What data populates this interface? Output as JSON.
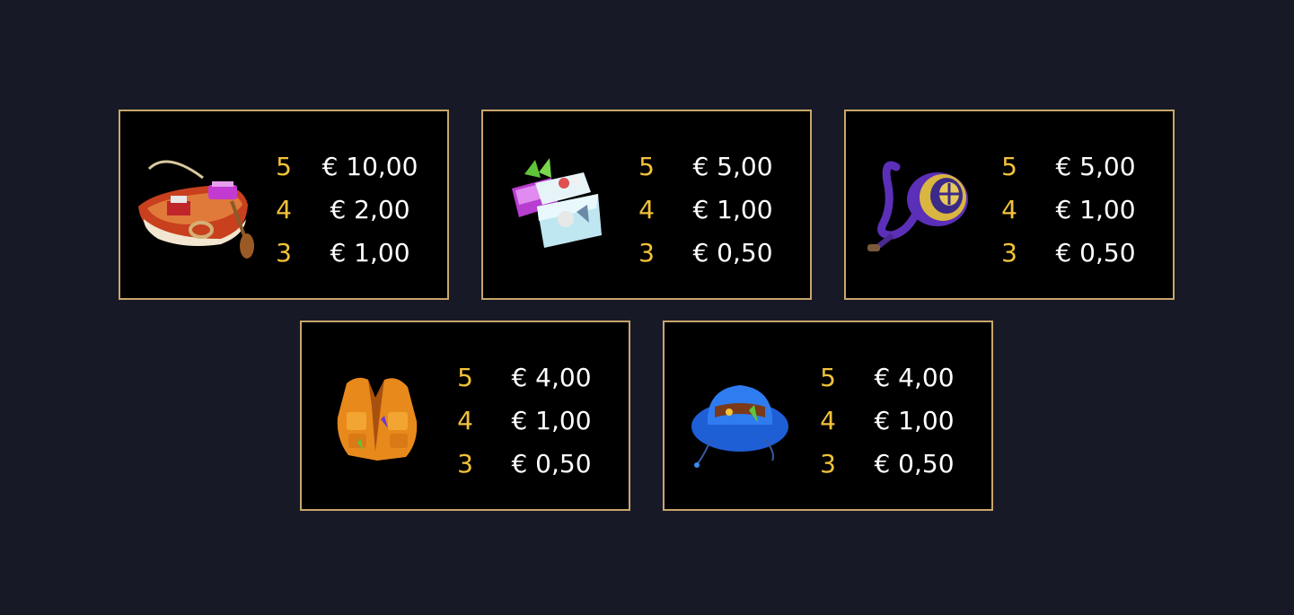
{
  "paytable": [
    {
      "symbol": "rowboat-icon",
      "payouts": [
        {
          "count": "5",
          "amount": "€ 10,00"
        },
        {
          "count": "4",
          "amount": "€ 2,00"
        },
        {
          "count": "3",
          "amount": "€ 1,00"
        }
      ]
    },
    {
      "symbol": "tackle-box-icon",
      "payouts": [
        {
          "count": "5",
          "amount": "€ 5,00"
        },
        {
          "count": "4",
          "amount": "€ 1,00"
        },
        {
          "count": "3",
          "amount": "€ 0,50"
        }
      ]
    },
    {
      "symbol": "fishing-reel-icon",
      "payouts": [
        {
          "count": "5",
          "amount": "€ 5,00"
        },
        {
          "count": "4",
          "amount": "€ 1,00"
        },
        {
          "count": "3",
          "amount": "€ 0,50"
        }
      ]
    },
    {
      "symbol": "fishing-vest-icon",
      "payouts": [
        {
          "count": "5",
          "amount": "€ 4,00"
        },
        {
          "count": "4",
          "amount": "€ 1,00"
        },
        {
          "count": "3",
          "amount": "€ 0,50"
        }
      ]
    },
    {
      "symbol": "bucket-hat-icon",
      "payouts": [
        {
          "count": "5",
          "amount": "€ 4,00"
        },
        {
          "count": "4",
          "amount": "€ 1,00"
        },
        {
          "count": "3",
          "amount": "€ 0,50"
        }
      ]
    }
  ],
  "colors": {
    "background": "#171a26",
    "card_border": "#c9a66b",
    "count_text": "#f2c23a",
    "amount_text": "#ffffff"
  }
}
